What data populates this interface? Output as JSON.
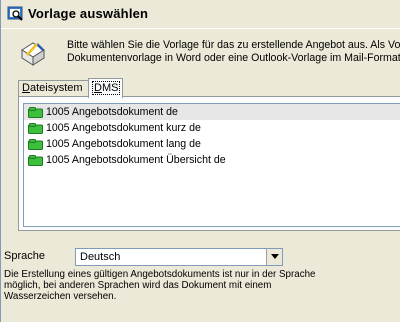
{
  "window": {
    "title": "Vorlage auswählen"
  },
  "intro": {
    "line1": "Bitte wählen Sie die Vorlage für das zu erstellende Angebot aus. Als Vorl",
    "line2": "Dokumentenvorlage in Word oder eine Outlook-Vorlage im Mail-Format o"
  },
  "tabs": [
    {
      "label_pre": "",
      "label_u": "D",
      "label_post": "ateisystem",
      "active": false
    },
    {
      "label_pre": "",
      "label_u": "D",
      "label_post": "MS",
      "active": true
    }
  ],
  "templates": [
    {
      "label": "1005 Angebotsdokument de",
      "icon": "template-folder-icon",
      "selected": true
    },
    {
      "label": "1005 Angebotsdokument kurz de",
      "icon": "template-folder-icon",
      "selected": false
    },
    {
      "label": "1005 Angebotsdokument lang de",
      "icon": "template-folder-icon",
      "selected": false
    },
    {
      "label": "1005 Angebotsdokument Übersicht de",
      "icon": "template-folder-icon",
      "selected": false
    }
  ],
  "language": {
    "label": "Sprache",
    "value": "Deutsch"
  },
  "note": {
    "line1": "Die Erstellung eines gültigen Angebotsdokuments ist nur in der Sprache",
    "line2": "möglich, bei anderen Sprachen wird das Dokument mit einem",
    "line3": "Wasserzeichen versehen."
  },
  "colors": {
    "dialog_bg": "#ece9d8",
    "list_selection": "#e6e6e6",
    "folder_icon": "#3cbf3c"
  }
}
